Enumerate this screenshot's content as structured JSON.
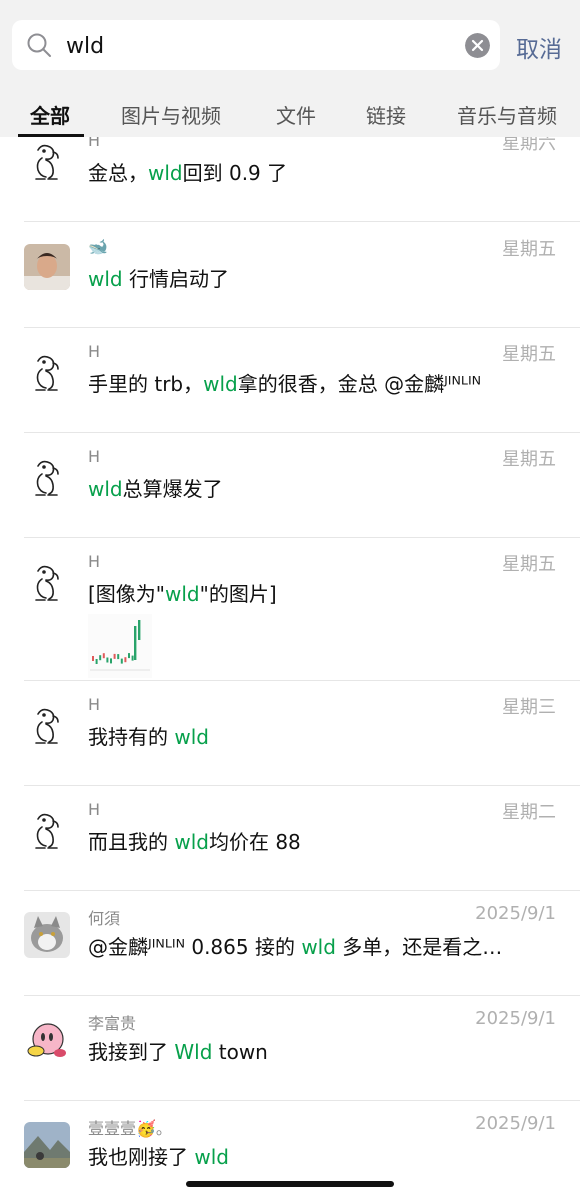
{
  "search": {
    "value": "wld",
    "cancel_label": "取消"
  },
  "tabs": [
    {
      "label": "全部",
      "active": true
    },
    {
      "label": "图片与视频",
      "active": false
    },
    {
      "label": "文件",
      "active": false
    },
    {
      "label": "链接",
      "active": false
    },
    {
      "label": "音乐与音频",
      "active": false
    }
  ],
  "colors": {
    "highlight": "#07a04b",
    "link_blue": "#576b95"
  },
  "results": [
    {
      "name": "H",
      "time": "星期六",
      "avatar": "dog-sketch-icon",
      "segments": [
        {
          "t": "金总，"
        },
        {
          "t": "wld",
          "hl": true
        },
        {
          "t": "回到 0.9 了"
        }
      ]
    },
    {
      "name": "🐋",
      "time": "星期五",
      "avatar": "man-photo-avatar",
      "segments": [
        {
          "t": "wld",
          "hl": true
        },
        {
          "t": " 行情启动了"
        }
      ]
    },
    {
      "name": "H",
      "time": "星期五",
      "avatar": "dog-sketch-icon",
      "segments": [
        {
          "t": "手里的 trb，"
        },
        {
          "t": "wld",
          "hl": true
        },
        {
          "t": "拿的很香，金总 @金麟ᴶᴵᴺᴸᴵᴺ"
        }
      ]
    },
    {
      "name": "H",
      "time": "星期五",
      "avatar": "dog-sketch-icon",
      "segments": [
        {
          "t": "wld",
          "hl": true
        },
        {
          "t": "总算爆发了"
        }
      ]
    },
    {
      "name": "H",
      "time": "星期五",
      "avatar": "dog-sketch-icon",
      "has_image": true,
      "segments": [
        {
          "t": "[图像为\""
        },
        {
          "t": "wld",
          "hl": true
        },
        {
          "t": "\"的图片]"
        }
      ]
    },
    {
      "name": "H",
      "time": "星期三",
      "avatar": "dog-sketch-icon",
      "segments": [
        {
          "t": "我持有的 "
        },
        {
          "t": "wld",
          "hl": true
        }
      ]
    },
    {
      "name": "H",
      "time": "星期二",
      "avatar": "dog-sketch-icon",
      "segments": [
        {
          "t": "而且我的 "
        },
        {
          "t": "wld",
          "hl": true
        },
        {
          "t": "均价在 88"
        }
      ]
    },
    {
      "name": "何須",
      "time": "2025/9/1",
      "avatar": "cat-photo-avatar",
      "segments": [
        {
          "t": "@金麟ᴶᴵᴺᴸᴵᴺ 0.865 接的 "
        },
        {
          "t": "wld",
          "hl": true
        },
        {
          "t": " 多单，还是看之…"
        }
      ]
    },
    {
      "name": "李富贵",
      "time": "2025/9/1",
      "avatar": "kirby-avatar",
      "segments": [
        {
          "t": "我接到了 "
        },
        {
          "t": "Wld",
          "hl": true
        },
        {
          "t": " town"
        }
      ]
    },
    {
      "name": "壹壹壹🥳。",
      "time": "2025/9/1",
      "avatar": "landscape-photo-avatar",
      "segments": [
        {
          "t": "我也刚接了 "
        },
        {
          "t": "wld",
          "hl": true
        }
      ]
    }
  ]
}
